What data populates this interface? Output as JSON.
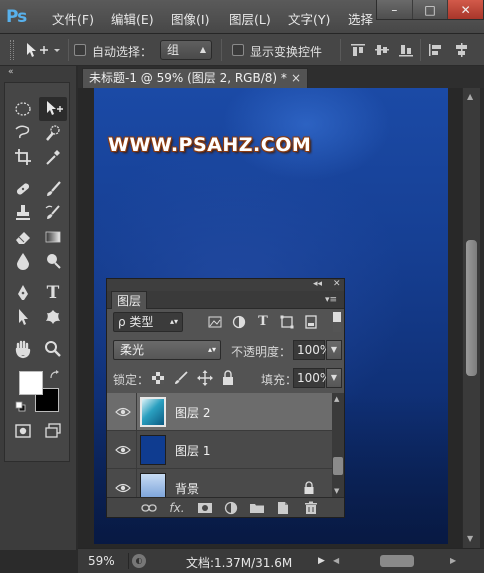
{
  "app": {
    "logo": "Ps",
    "menu": [
      "文件(F)",
      "编辑(E)",
      "图像(I)",
      "图层(L)",
      "文字(Y)",
      "选择"
    ],
    "window_buttons": [
      "–",
      "□",
      "✕"
    ]
  },
  "options_bar": {
    "tool_icon": "move-tool-icon",
    "auto_select_label": "自动选择：",
    "auto_select_checked": false,
    "auto_select_target": "组",
    "show_transform_label": "显示变换控件",
    "show_transform_checked": false
  },
  "toolbox": {
    "collapse_glyph": "«",
    "tools": [
      "marquee-icon",
      "move-icon",
      "lasso-icon",
      "quick-select-icon",
      "crop-icon",
      "eyedropper-icon",
      "healing-icon",
      "brush-icon",
      "stamp-icon",
      "history-brush-icon",
      "eraser-icon",
      "gradient-icon",
      "blur-icon",
      "dodge-icon",
      "pen-icon",
      "type-icon",
      "path-select-icon",
      "shape-icon",
      "hand-icon",
      "zoom-icon"
    ],
    "type_glyph": "T",
    "foreground_color": "#ffffff",
    "background_color": "#000000"
  },
  "document": {
    "tab_title": "未标题-1 @ 59% (图层 2, RGB/8) *",
    "close_glyph": "×",
    "canvas_text": "WWW.PSAHZ.COM"
  },
  "layers_panel": {
    "tab_label": "图层",
    "collapse_glyph": "◂◂",
    "close_glyph": "✕",
    "menu_glyph": "▾≡",
    "filter_label": "ρ 类型",
    "filter_icons": [
      "image-filter-icon",
      "adjustment-filter-icon",
      "type-filter-icon",
      "shape-filter-icon",
      "smart-object-filter-icon"
    ],
    "blend_mode": "柔光",
    "opacity_label": "不透明度：",
    "opacity_value": "100%",
    "lock_label": "锁定：",
    "fill_label": "填充：",
    "fill_value": "100%",
    "layers": [
      {
        "name": "图层 2",
        "visible": true,
        "selected": true,
        "thumb_color": "#2aa0c0"
      },
      {
        "name": "图层 1",
        "visible": true,
        "selected": false,
        "thumb_color": "#0f3c90"
      },
      {
        "name": "背景",
        "visible": true,
        "selected": false,
        "locked": true,
        "thumb_color": "#8ab0e0"
      }
    ],
    "footer_icons": [
      "link-layers-icon",
      "fx-icon",
      "mask-icon",
      "adjustment-layer-icon",
      "group-folder-icon",
      "new-layer-icon",
      "trash-icon"
    ],
    "fx_label": "fx."
  },
  "status_bar": {
    "zoom": "59%",
    "doc_info": "文档:1.37M/31.6M"
  }
}
